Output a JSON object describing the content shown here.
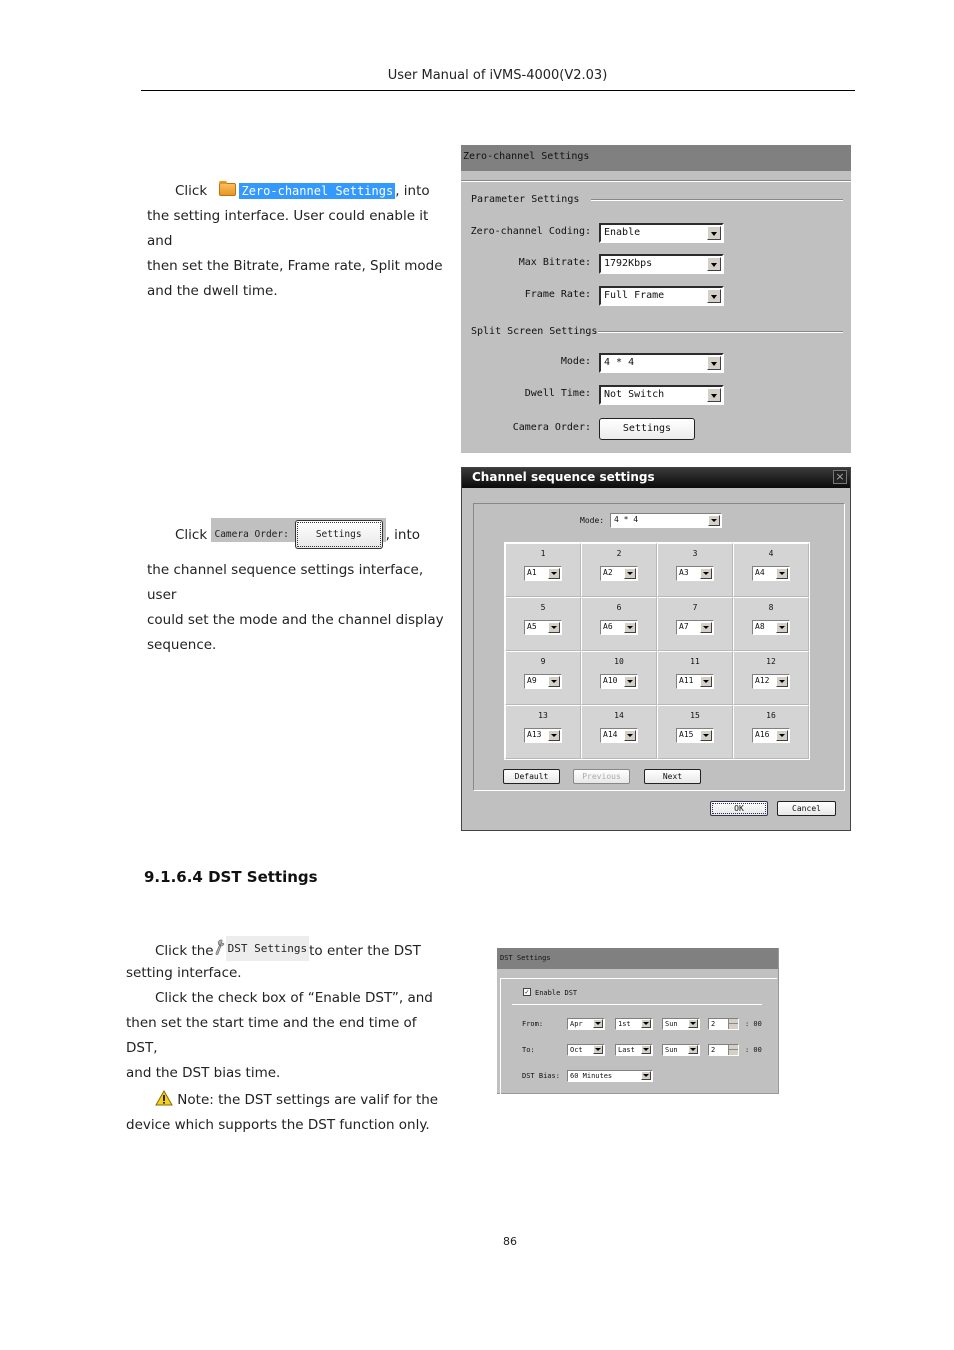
{
  "header": {
    "title": "User Manual of iVMS-4000(V2.03)"
  },
  "section1": {
    "click_word": "Click",
    "inline_button": "Zero-channel Settings",
    "line1_tail": ", into",
    "line2": "the setting interface. User could enable it and",
    "line3": "then set the Bitrate, Frame rate, Split mode",
    "line4": "and the dwell time."
  },
  "zero_channel_panel": {
    "title": "Zero-channel Settings",
    "parameter_group": "Parameter Settings",
    "split_group": "Split Screen Settings",
    "fields": {
      "coding_label": "Zero-channel Coding:",
      "coding_value": "Enable",
      "bitrate_label": "Max Bitrate:",
      "bitrate_value": "1792Kbps",
      "framerate_label": "Frame Rate:",
      "framerate_value": "Full Frame",
      "mode_label": "Mode:",
      "mode_value": "4 * 4",
      "dwell_label": "Dwell Time:",
      "dwell_value": "Not Switch",
      "camera_order_label": "Camera Order:",
      "settings_button": "Settings"
    }
  },
  "section2": {
    "click_word": "Click",
    "snippet_label": "Camera Order:",
    "snippet_button": "Settings",
    "line1_tail": ", into",
    "line2": "the channel sequence settings interface, user",
    "line3": "could set the mode and the channel display",
    "line4": "sequence."
  },
  "channel_sequence_dialog": {
    "title": "Channel sequence settings",
    "close": "×",
    "mode_label": "Mode:",
    "mode_value": "4 * 4",
    "cells": [
      {
        "num": "1",
        "value": "A1"
      },
      {
        "num": "2",
        "value": "A2"
      },
      {
        "num": "3",
        "value": "A3"
      },
      {
        "num": "4",
        "value": "A4"
      },
      {
        "num": "5",
        "value": "A5"
      },
      {
        "num": "6",
        "value": "A6"
      },
      {
        "num": "7",
        "value": "A7"
      },
      {
        "num": "8",
        "value": "A8"
      },
      {
        "num": "9",
        "value": "A9"
      },
      {
        "num": "10",
        "value": "A10"
      },
      {
        "num": "11",
        "value": "A11"
      },
      {
        "num": "12",
        "value": "A12"
      },
      {
        "num": "13",
        "value": "A13"
      },
      {
        "num": "14",
        "value": "A14"
      },
      {
        "num": "15",
        "value": "A15"
      },
      {
        "num": "16",
        "value": "A16"
      }
    ],
    "buttons": {
      "default": "Default",
      "previous": "Previous",
      "next": "Next",
      "ok": "OK",
      "cancel": "Cancel"
    }
  },
  "dst_section": {
    "heading": "9.1.6.4 DST Settings",
    "click_the": "Click the",
    "inline_button": "DST Settings",
    "line1_tail": "to enter the DST",
    "line2": "setting interface.",
    "line3": "Click the check box of “Enable DST”, and",
    "line4": "then set the start time and the end time of DST,",
    "line5": "and the DST bias time.",
    "note_line1": "Note: the DST settings are valif for the",
    "note_line2": "device which supports the DST function only."
  },
  "dst_panel": {
    "title": "DST Settings",
    "enable_label": "Enable  DST",
    "enable_checked": true,
    "from_label": "From:",
    "from": {
      "month": "Apr",
      "week": "1st",
      "day": "Sun",
      "hour": "2",
      "suffix": ": 00"
    },
    "to_label": "To:",
    "to": {
      "month": "Oct",
      "week": "Last",
      "day": "Sun",
      "hour": "2",
      "suffix": ": 00"
    },
    "bias_label": "DST Bias:",
    "bias_value": "60  Minutes"
  },
  "footer": {
    "page_number": "86"
  }
}
